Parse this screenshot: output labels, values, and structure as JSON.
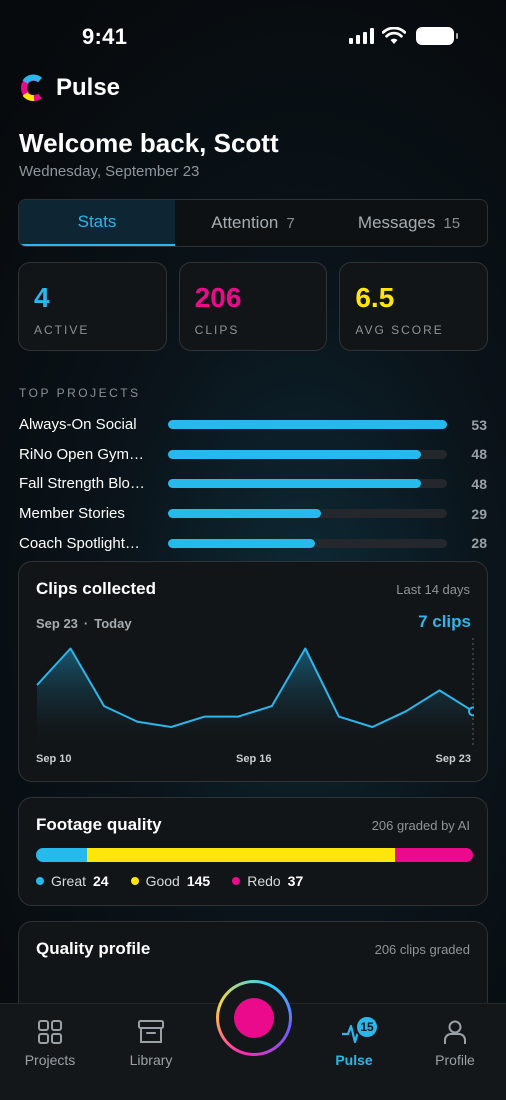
{
  "status_bar": {
    "time": "9:41"
  },
  "app": {
    "name": "Pulse",
    "colors": {
      "cyan": "#2bb6ec",
      "magenta": "#ec0a8c",
      "yellow": "#ffe60a"
    }
  },
  "header": {
    "welcome": "Welcome back, Scott",
    "date": "Wednesday, September 23"
  },
  "tabs": [
    {
      "label": "Stats",
      "count": ""
    },
    {
      "label": "Attention",
      "count": "7"
    },
    {
      "label": "Messages",
      "count": "15"
    }
  ],
  "stats": [
    {
      "value": "4",
      "label": "ACTIVE",
      "color": "#2bb6ec"
    },
    {
      "value": "206",
      "label": "CLIPS",
      "color": "#ec0a8c"
    },
    {
      "value": "6.5",
      "label": "AVG SCORE",
      "color": "#ffe60a"
    }
  ],
  "top_projects": {
    "title": "TOP PROJECTS",
    "max": 53,
    "items": [
      {
        "name": "Always-On Social",
        "count": 53
      },
      {
        "name": "RiNo Open Gym…",
        "count": 48
      },
      {
        "name": "Fall Strength Blo…",
        "count": 48
      },
      {
        "name": "Member Stories",
        "count": 29
      },
      {
        "name": "Coach Spotlight…",
        "count": 28
      }
    ]
  },
  "clips_collected": {
    "title": "Clips collected",
    "range": "Last 14 days",
    "selection_start": "Sep 23",
    "selection_end": "Today",
    "selection_value": "7 clips",
    "x_ticks": [
      "Sep 10",
      "Sep 16",
      "Sep 23"
    ]
  },
  "chart_data": {
    "type": "area",
    "x": [
      "Sep 10",
      "Sep 11",
      "Sep 12",
      "Sep 13",
      "Sep 14",
      "Sep 15",
      "Sep 16",
      "Sep 17",
      "Sep 18",
      "Sep 19",
      "Sep 20",
      "Sep 21",
      "Sep 22",
      "Sep 23"
    ],
    "series": [
      {
        "values": [
          12,
          19,
          8,
          5,
          4,
          6,
          6,
          8,
          19,
          6,
          4,
          7,
          11,
          7
        ]
      }
    ],
    "highlight_index": 13,
    "ylim": [
      0,
      21
    ]
  },
  "footage_quality": {
    "title": "Footage quality",
    "meta": "206 graded by AI",
    "segments": [
      {
        "label": "Great",
        "value": 24,
        "color": "#25b9ec"
      },
      {
        "label": "Good",
        "value": 145,
        "color": "#ffe60a"
      },
      {
        "label": "Redo",
        "value": 37,
        "color": "#ec0a8c"
      }
    ]
  },
  "quality_profile": {
    "title": "Quality profile",
    "meta": "206 clips graded"
  },
  "tabbar": {
    "items": [
      {
        "label": "Projects",
        "icon": "grid-icon"
      },
      {
        "label": "Library",
        "icon": "archive-icon"
      },
      {
        "label": "Pulse",
        "icon": "pulse-icon",
        "badge": "15"
      },
      {
        "label": "Profile",
        "icon": "person-icon"
      }
    ]
  }
}
